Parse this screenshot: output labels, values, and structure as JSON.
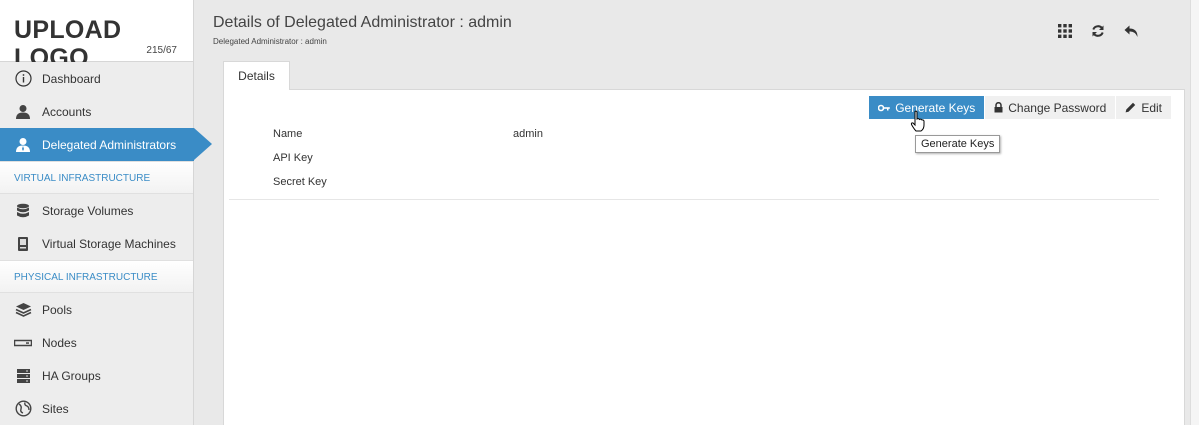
{
  "logo": {
    "text": "UPLOAD LOGO",
    "sub": "215/67"
  },
  "sidebar": {
    "items": [
      {
        "label": "Dashboard",
        "icon": "info-icon"
      },
      {
        "label": "Accounts",
        "icon": "user-icon"
      },
      {
        "label": "Delegated Administrators",
        "icon": "admin-icon",
        "active": true
      }
    ],
    "section_virtual": "VIRTUAL INFRASTRUCTURE",
    "virtual_items": [
      {
        "label": "Storage Volumes",
        "icon": "database-icon"
      },
      {
        "label": "Virtual Storage Machines",
        "icon": "machine-icon"
      }
    ],
    "section_physical": "PHYSICAL INFRASTRUCTURE",
    "physical_items": [
      {
        "label": "Pools",
        "icon": "layers-icon"
      },
      {
        "label": "Nodes",
        "icon": "node-icon"
      },
      {
        "label": "HA Groups",
        "icon": "server-stack-icon"
      },
      {
        "label": "Sites",
        "icon": "globe-icon"
      }
    ]
  },
  "header": {
    "title": "Details of Delegated Administrator : admin",
    "subtitle": "Delegated Administrator : admin"
  },
  "tabs": {
    "details": "Details"
  },
  "actions": {
    "generate_keys": "Generate Keys",
    "change_password": "Change Password",
    "edit": "Edit"
  },
  "tooltip": "Generate Keys",
  "details": {
    "name_label": "Name",
    "name_value": "admin",
    "api_key_label": "API Key",
    "secret_key_label": "Secret Key"
  },
  "colors": {
    "accent": "#3a8cc6",
    "background": "#e9e9e9"
  }
}
